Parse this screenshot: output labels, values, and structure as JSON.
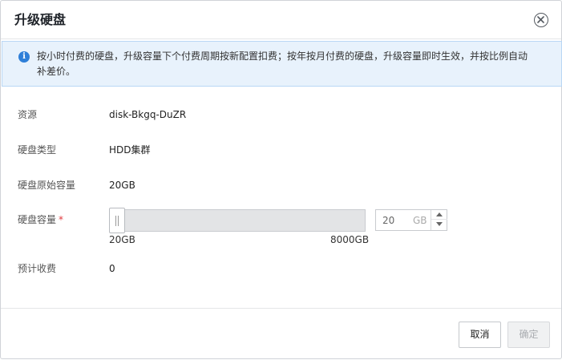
{
  "dialog": {
    "title": "升级硬盘",
    "notice": "按小时付费的硬盘，升级容量下个付费周期按新配置扣费；按年按月付费的硬盘，升级容量即时生效，并按比例自动补差价。"
  },
  "form": {
    "resource_label": "资源",
    "resource_value": "disk-Bkgq-DuZR",
    "type_label": "硬盘类型",
    "type_value": "HDD集群",
    "original_label": "硬盘原始容量",
    "original_value": "20GB",
    "capacity_label": "硬盘容量",
    "required_mark": "*",
    "slider_min": "20GB",
    "slider_max": "8000GB",
    "slider_position": 0.0,
    "capacity_input_value": "20",
    "capacity_unit": "GB",
    "fee_label": "预计收费",
    "fee_value": "0"
  },
  "footer": {
    "cancel_label": "取消",
    "confirm_label": "确定"
  },
  "icons": {
    "close": "close-circle-icon",
    "info": "info-icon",
    "up": "caret-up-icon",
    "down": "caret-down-icon"
  },
  "colors": {
    "accent": "#2e7fd8",
    "notice_bg": "#e8f2fc",
    "required": "#e0393e"
  }
}
